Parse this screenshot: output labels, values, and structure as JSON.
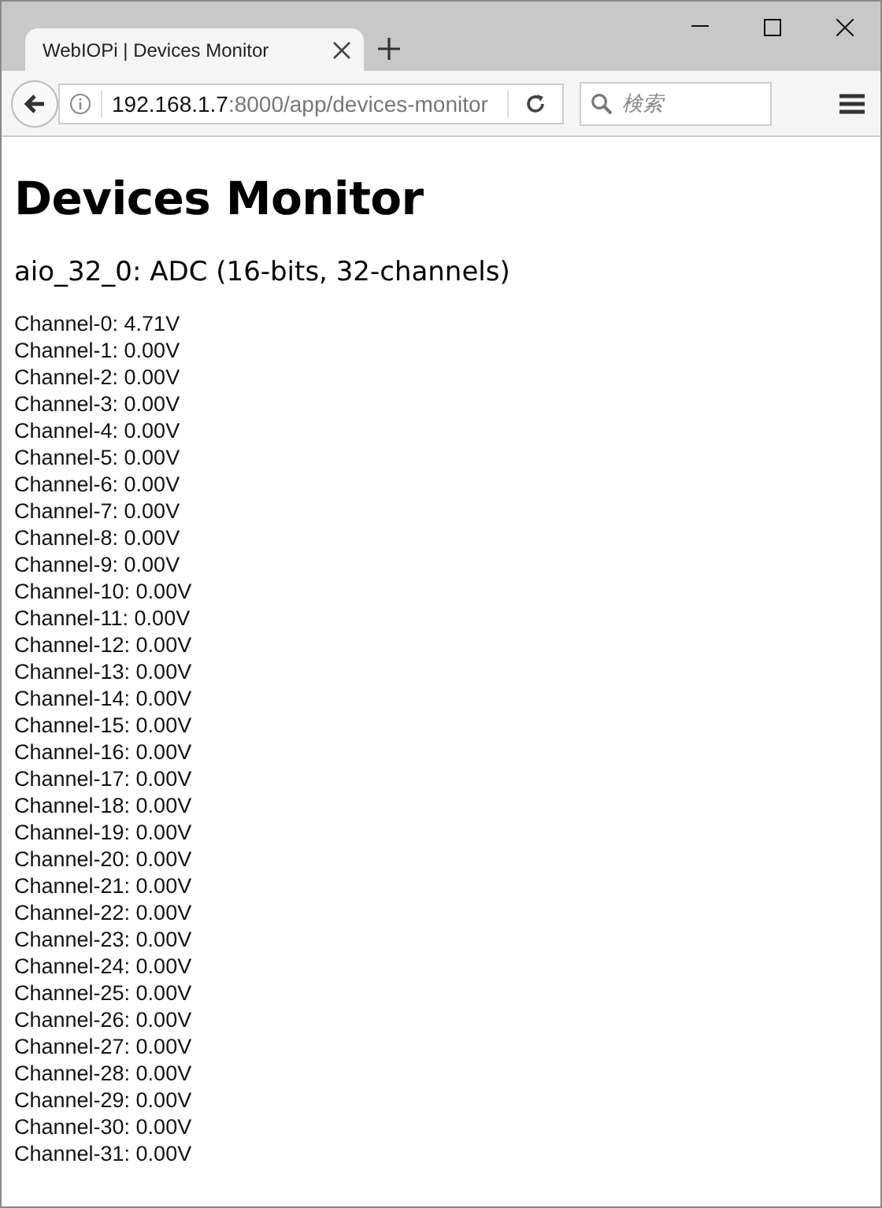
{
  "tab": {
    "title": "WebIOPi | Devices Monitor",
    "selected": true
  },
  "address": {
    "host": "192.168.1.7",
    "rest": ":8000/app/devices-monitor"
  },
  "search": {
    "placeholder": "検索"
  },
  "heading": "Devices Monitor",
  "device": "aio_32_0: ADC (16-bits, 32-channels)",
  "channels": [
    "Channel-0: 4.71V",
    "Channel-1: 0.00V",
    "Channel-2: 0.00V",
    "Channel-3: 0.00V",
    "Channel-4: 0.00V",
    "Channel-5: 0.00V",
    "Channel-6: 0.00V",
    "Channel-7: 0.00V",
    "Channel-8: 0.00V",
    "Channel-9: 0.00V",
    "Channel-10: 0.00V",
    "Channel-11: 0.00V",
    "Channel-12: 0.00V",
    "Channel-13: 0.00V",
    "Channel-14: 0.00V",
    "Channel-15: 0.00V",
    "Channel-16: 0.00V",
    "Channel-17: 0.00V",
    "Channel-18: 0.00V",
    "Channel-19: 0.00V",
    "Channel-20: 0.00V",
    "Channel-21: 0.00V",
    "Channel-22: 0.00V",
    "Channel-23: 0.00V",
    "Channel-24: 0.00V",
    "Channel-25: 0.00V",
    "Channel-26: 0.00V",
    "Channel-27: 0.00V",
    "Channel-28: 0.00V",
    "Channel-29: 0.00V",
    "Channel-30: 0.00V",
    "Channel-31: 0.00V"
  ]
}
